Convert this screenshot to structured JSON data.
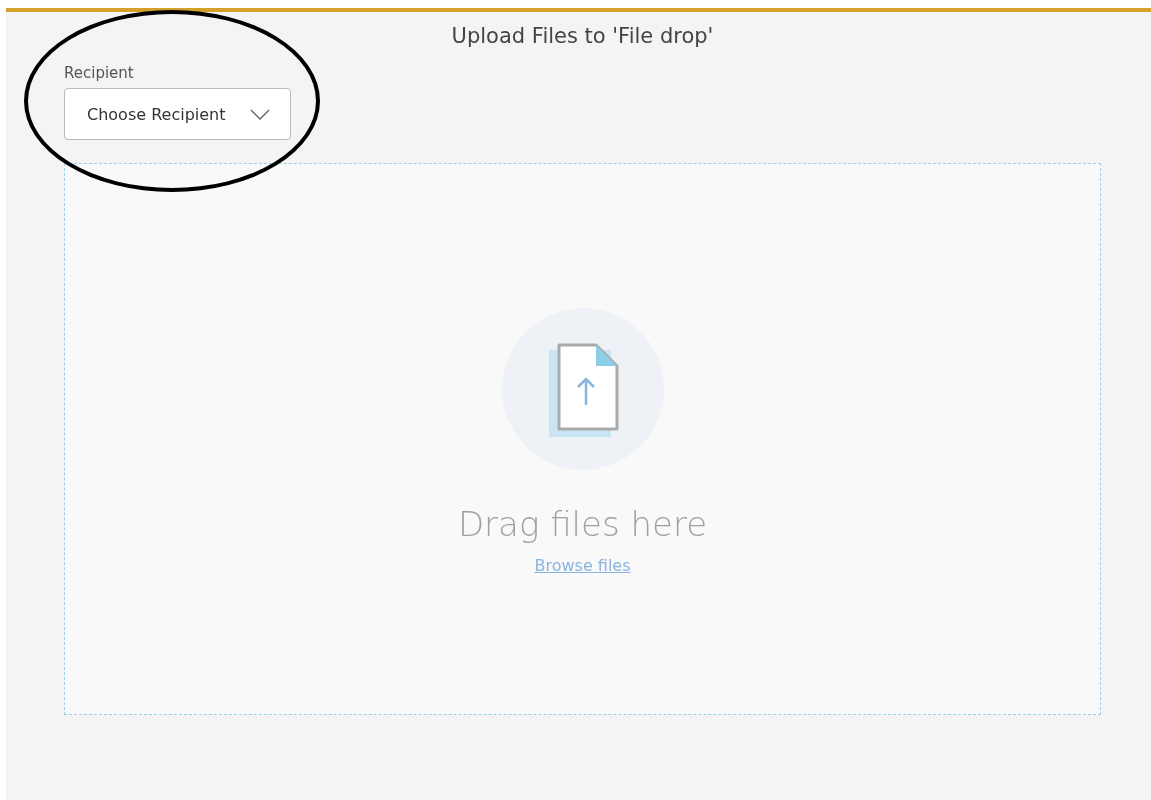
{
  "title": "Upload Files to 'File drop'",
  "recipient": {
    "label": "Recipient",
    "placeholder": "Choose Recipient"
  },
  "drop_zone": {
    "message": "Drag files here",
    "link": "Browse files"
  },
  "annotation": {
    "kind": "ellipse"
  }
}
